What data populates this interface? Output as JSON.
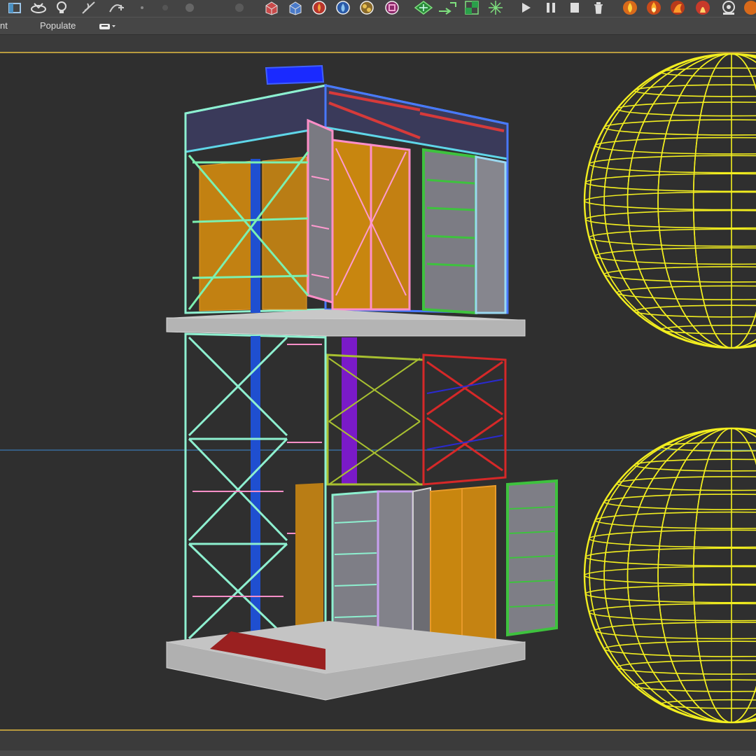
{
  "toolbar": {
    "icons": [
      "select-object-icon",
      "select-by-name-icon",
      "lightbulb-icon",
      "link-icon",
      "bind-icon",
      "snap-toggle-icon",
      "render-setup-icon",
      "material-editor-icon",
      "render-frame-icon",
      "fire-effect-icon",
      "water-effect-icon",
      "particles-icon",
      "particle-view-icon",
      "hierarchy-icon",
      "move-icon",
      "grid-icon",
      "burst-icon",
      "play-icon",
      "pause-icon",
      "stop-icon",
      "reset-icon",
      "flame-icon-1",
      "flame-icon-2",
      "flame-icon-3",
      "flame-icon-4",
      "settings-icon"
    ]
  },
  "ribbon": {
    "tabs": [
      {
        "label": "nt"
      },
      {
        "label": "Populate"
      }
    ]
  },
  "viewport": {
    "objects": [
      "scaffold-tower",
      "wireframe-sphere-top",
      "wireframe-sphere-bottom"
    ],
    "colors": {
      "background": "#2f2f2f",
      "sphere": "#f2ee1f",
      "border": "#b89a3e",
      "horizon": "#3d8bd4"
    }
  }
}
